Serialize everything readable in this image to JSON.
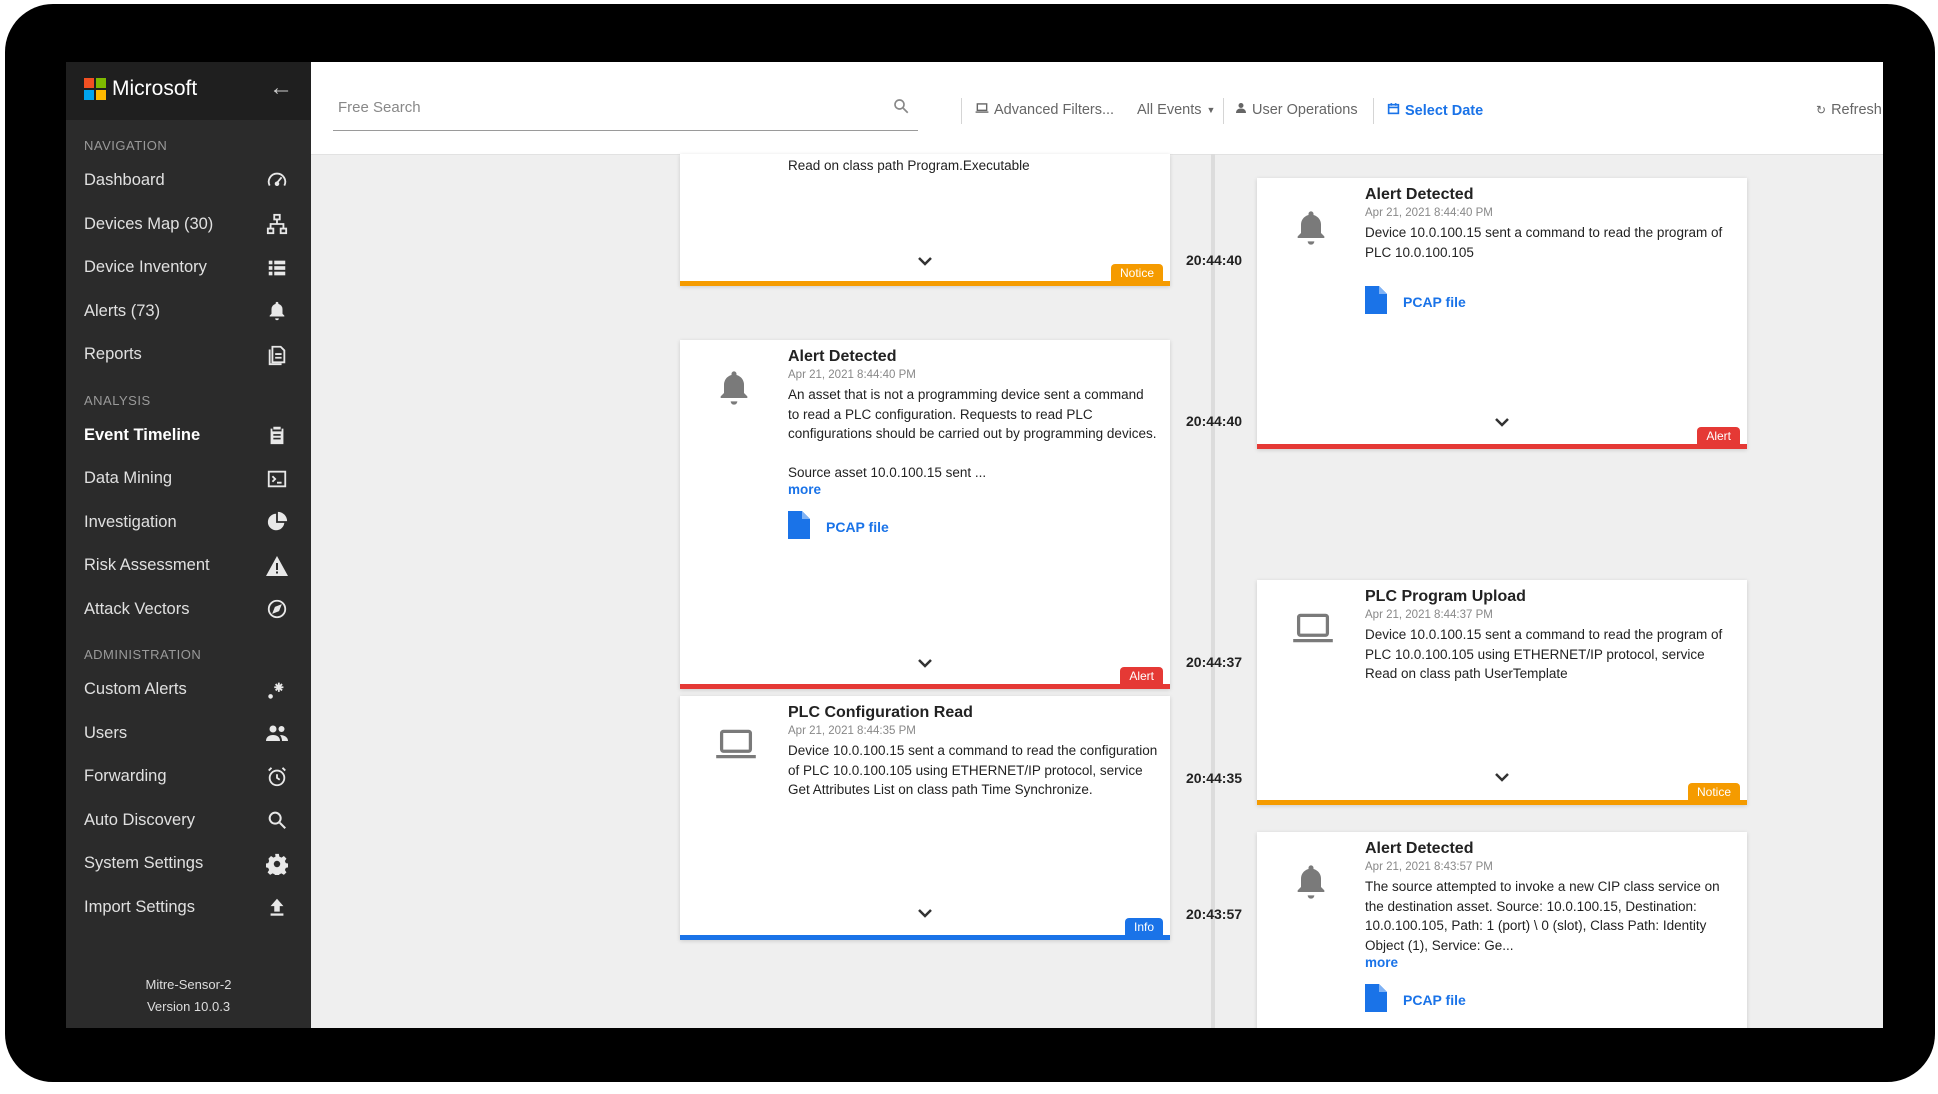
{
  "brand": {
    "name": "Microsoft",
    "logo_colors": [
      "#f25022",
      "#7fba00",
      "#00a4ef",
      "#ffb900"
    ]
  },
  "sidebar": {
    "sections": {
      "navigation": "NAVIGATION",
      "analysis": "ANALYSIS",
      "administration": "ADMINISTRATION"
    },
    "nav": [
      {
        "label": "Dashboard",
        "icon": "speedometer-icon"
      },
      {
        "label": "Devices Map (30)",
        "icon": "network-icon"
      },
      {
        "label": "Device Inventory",
        "icon": "list-icon"
      },
      {
        "label": "Alerts (73)",
        "icon": "bell-icon"
      },
      {
        "label": "Reports",
        "icon": "document-icon"
      }
    ],
    "analysis": [
      {
        "label": "Event Timeline",
        "icon": "clipboard-icon",
        "active": true
      },
      {
        "label": "Data Mining",
        "icon": "terminal-icon"
      },
      {
        "label": "Investigation",
        "icon": "pie-chart-icon"
      },
      {
        "label": "Risk Assessment",
        "icon": "warning-icon"
      },
      {
        "label": "Attack Vectors",
        "icon": "compass-icon"
      }
    ],
    "administration": [
      {
        "label": "Custom Alerts",
        "icon": "sparkle-icon"
      },
      {
        "label": "Users",
        "icon": "users-icon"
      },
      {
        "label": "Forwarding",
        "icon": "alarm-clock-icon"
      },
      {
        "label": "Auto Discovery",
        "icon": "search-icon"
      },
      {
        "label": "System Settings",
        "icon": "gear-icon"
      },
      {
        "label": "Import Settings",
        "icon": "upload-icon"
      }
    ],
    "footer": {
      "sensor": "Mitre-Sensor-2",
      "version": "Version 10.0.3"
    }
  },
  "toolbar": {
    "search_placeholder": "Free Search",
    "advanced_filters": "Advanced Filters...",
    "all_events": "All Events",
    "user_operations": "User Operations",
    "select_date": "Select Date",
    "refresh": "Refresh"
  },
  "timeline": {
    "times": [
      "20:44:40",
      "20:44:40",
      "20:44:37",
      "20:44:35",
      "20:43:57"
    ],
    "cards": {
      "left_top": {
        "desc": "Read on class path Program.Executable",
        "badge": "Notice"
      },
      "right_1": {
        "title": "Alert Detected",
        "date": "Apr 21, 2021 8:44:40 PM",
        "desc": "Device 10.0.100.15 sent a command to read the program of PLC 10.0.100.105",
        "pcap": "PCAP file",
        "badge": "Alert"
      },
      "left_2": {
        "title": "Alert Detected",
        "date": "Apr 21, 2021 8:44:40 PM",
        "desc": "An asset that is not a programming device sent a command to read a PLC configuration. Requests to read PLC configurations should be carried out by programming devices.",
        "desc2": "Source asset 10.0.100.15 sent ...",
        "more": "more",
        "pcap": "PCAP file",
        "badge": "Alert"
      },
      "right_2": {
        "title": "PLC Program Upload",
        "date": "Apr 21, 2021 8:44:37 PM",
        "desc": "Device 10.0.100.15 sent a command to read the program of PLC 10.0.100.105 using ETHERNET/IP protocol, service Read on class path UserTemplate",
        "badge": "Notice"
      },
      "left_3": {
        "title": "PLC Configuration Read",
        "date": "Apr 21, 2021 8:44:35 PM",
        "desc": "Device 10.0.100.15 sent a command to read the configuration of PLC 10.0.100.105 using ETHERNET/IP protocol, service Get Attributes List on class path Time Synchronize.",
        "badge": "Info"
      },
      "right_3": {
        "title": "Alert Detected",
        "date": "Apr 21, 2021 8:43:57 PM",
        "desc": "The source attempted to invoke a new CIP class service on the destination asset. Source: 10.0.100.15, Destination: 10.0.100.105, Path: 1 (port) \\ 0 (slot), Class Path: Identity Object (1), Service: Ge...",
        "more": "more",
        "pcap": "PCAP file"
      }
    }
  }
}
